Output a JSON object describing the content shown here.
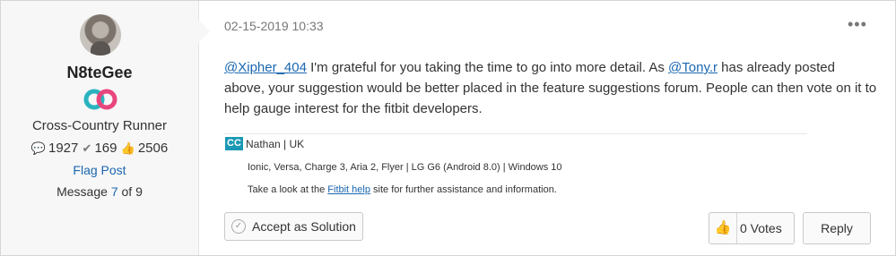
{
  "author": {
    "name": "N8teGee",
    "rank": "Cross-Country Runner",
    "stats": {
      "posts": "1927",
      "solutions": "169",
      "kudos": "2506"
    },
    "icons": {
      "posts": "speech-bubble-icon",
      "solutions": "checkmark-icon",
      "kudos": "thumbs-up-icon",
      "rank": "rank-badge-icon"
    }
  },
  "left_actions": {
    "flag_post": "Flag Post"
  },
  "message_count": {
    "prefix": "Message",
    "current": "7",
    "of": "of",
    "total": "9"
  },
  "post": {
    "timestamp": "02-15-2019 10:33",
    "more_icon": "•••",
    "mention1": "@Xipher_404",
    "text1": " I'm grateful for you taking the time to go into more detail. As ",
    "mention2": "@Tony.r",
    "text2": " has already posted above, your suggestion would be better placed in the feature suggestions forum. People can then vote on it to help gauge interest for the fitbit developers."
  },
  "signature": {
    "badge": "CC",
    "name": "Nathan | UK",
    "devices": "Ionic, Versa, Charge 3, Aria 2, Flyer | LG G6 (Android 8.0) | Windows 10",
    "help_prefix": "Take a look at the ",
    "help_link": "Fitbit help",
    "help_suffix": " site for further assistance and information."
  },
  "actions": {
    "accept": "Accept as Solution",
    "votes": "0 Votes",
    "reply": "Reply"
  },
  "colors": {
    "link": "#1a66b0",
    "badge": "#1a98b4",
    "rank_teal": "#2ab3bf",
    "rank_pink": "#e8467c"
  }
}
